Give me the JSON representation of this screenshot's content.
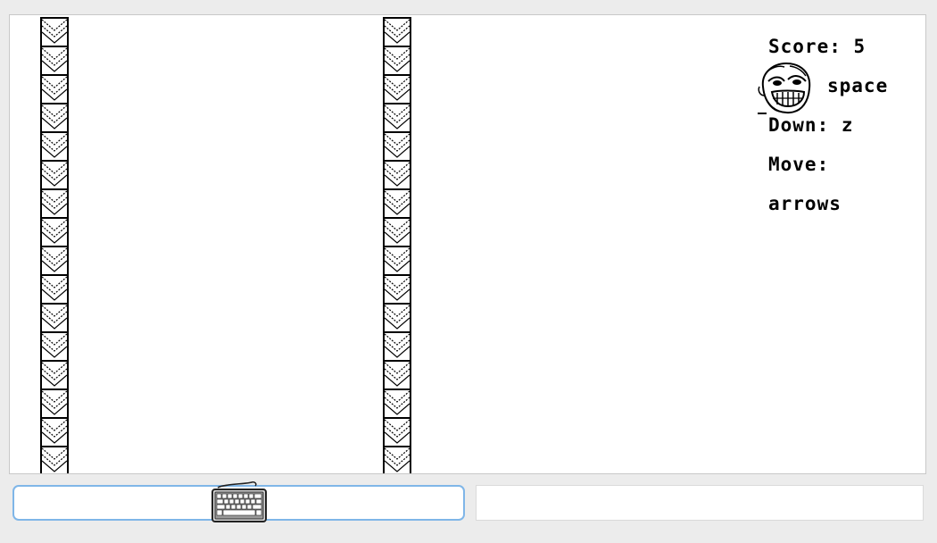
{
  "hud": {
    "score_label": "Score: 5",
    "jump_label": "space",
    "down_label": "Down: z",
    "move_label": "Move:",
    "move_keys": "arrows"
  },
  "icons": {
    "player": "troll-face-icon",
    "input_indicator": "keyboard-icon"
  },
  "colors": {
    "canvas_bg": "#ffffff",
    "page_bg": "#ececec",
    "focus_border": "#7fb6e8",
    "ink": "#000000"
  }
}
